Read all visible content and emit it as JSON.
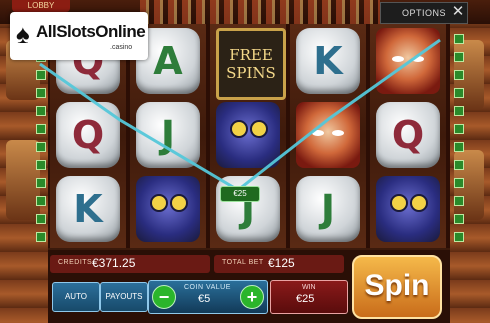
{
  "topbar": {
    "lobby_label": "LOBBY",
    "options_label": "OPTIONS",
    "close_glyph": "✕"
  },
  "logo": {
    "brand": "AllSlotsOnline",
    "sub": ".casino",
    "spade_glyph": "♠"
  },
  "reels": [
    [
      "Q",
      "Q",
      "K"
    ],
    [
      "A",
      "J",
      "owl"
    ],
    [
      "FREE SPINS",
      "owl",
      "J"
    ],
    [
      "K",
      "mask",
      "J"
    ],
    [
      "mask",
      "Q",
      "owl"
    ]
  ],
  "symbols": {
    "free_spins_text_line1": "FREE",
    "free_spins_text_line2": "SPINS",
    "letter_colors": {
      "A": "#2e7d3a",
      "K": "#2e6f8e",
      "Q": "#8e2a3a",
      "J": "#2e7d3a"
    }
  },
  "win_badge": "€25",
  "markers": {
    "left": [
      "1",
      "2",
      "3",
      "4",
      "5",
      "6",
      "7",
      "8",
      "9",
      "10",
      "11",
      "12",
      "13",
      "14",
      "15",
      "16",
      "17",
      "18",
      "19",
      "20"
    ]
  },
  "credits": {
    "label": "CREDITS",
    "value": "€371.25"
  },
  "total_bet": {
    "label": "TOTAL BET",
    "value": "€125"
  },
  "buttons": {
    "auto": "AUTO",
    "payouts": "PAYOUTS",
    "spin": "Spin",
    "minus": "−",
    "plus": "+"
  },
  "coin_value": {
    "label": "COIN VALUE",
    "value": "€5"
  },
  "win": {
    "label": "WIN",
    "value": "€25"
  },
  "colors": {
    "payline": "#54c7d9",
    "accent_spin": "#e8962f"
  }
}
